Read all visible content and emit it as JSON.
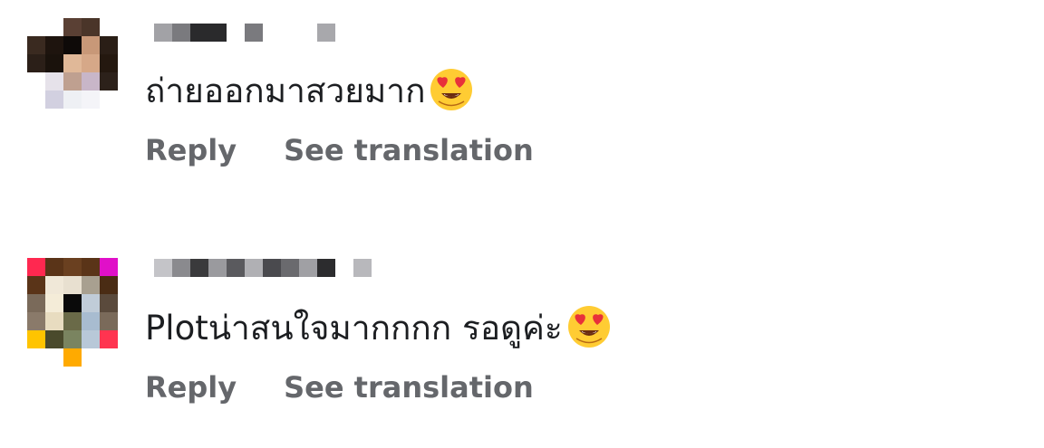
{
  "comments": [
    {
      "avatar_icon": "pixelated-avatar",
      "username_icon": "pixelated-username",
      "text": "ถ่ายออกมาสวยมาก",
      "emoji_icon": "heart-eyes-emoji",
      "reply_label": "Reply",
      "translate_label": "See translation"
    },
    {
      "avatar_icon": "pixelated-avatar",
      "username_icon": "pixelated-username",
      "text": "Plotน่าสนใจมากกกก รอดูค่ะ",
      "emoji_icon": "heart-eyes-emoji",
      "reply_label": "Reply",
      "translate_label": "See translation"
    }
  ],
  "colors": {
    "text": "#1c1e21",
    "secondary": "#65676b",
    "background": "#ffffff"
  }
}
